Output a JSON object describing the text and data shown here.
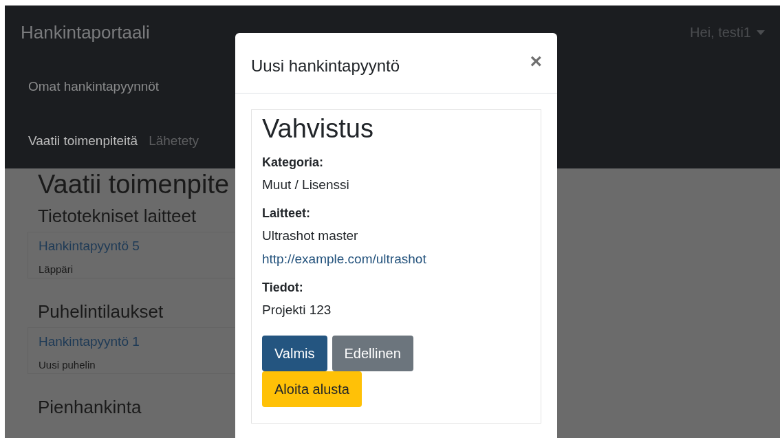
{
  "navbar": {
    "brand": "Hankintaportaali",
    "user_menu": "Hei, testi1",
    "primary_links": [
      {
        "label": "Omat hankintapyynnöt",
        "selected": false
      }
    ],
    "secondary_links": [
      {
        "label": "Vaatii toimenpiteitä",
        "selected": true
      },
      {
        "label": "Lähetety",
        "selected": false
      }
    ]
  },
  "page": {
    "heading": "Vaatii toimenpite",
    "sections": [
      {
        "title": "Tietotekniset laitteet",
        "requests": [
          {
            "title": "Hankintapyyntö 5",
            "description": "Läppäri"
          }
        ]
      },
      {
        "title": "Puhelintilaukset",
        "requests": [
          {
            "title": "Hankintapyyntö 1",
            "description": "Uusi puhelin"
          }
        ]
      },
      {
        "title": "Pienhankinta"
      }
    ]
  },
  "modal": {
    "title": "Uusi hankintapyyntö",
    "close": "×",
    "step_title": "Vahvistus",
    "fields": [
      {
        "label": "Kategoria:",
        "lines": [
          {
            "kind": "text",
            "text": "Muut / Lisenssi"
          }
        ]
      },
      {
        "label": "Laitteet:",
        "lines": [
          {
            "kind": "text",
            "text": "Ultrashot master"
          },
          {
            "kind": "link",
            "text": "http://example.com/ultrashot"
          }
        ]
      },
      {
        "label": "Tiedot:",
        "lines": [
          {
            "kind": "text",
            "text": "Projekti 123"
          }
        ]
      }
    ],
    "buttons": [
      {
        "label": "Valmis",
        "kind": "primary"
      },
      {
        "label": "Edellinen",
        "kind": "secondary"
      },
      {
        "label": "Aloita alusta",
        "kind": "warning"
      }
    ]
  }
}
